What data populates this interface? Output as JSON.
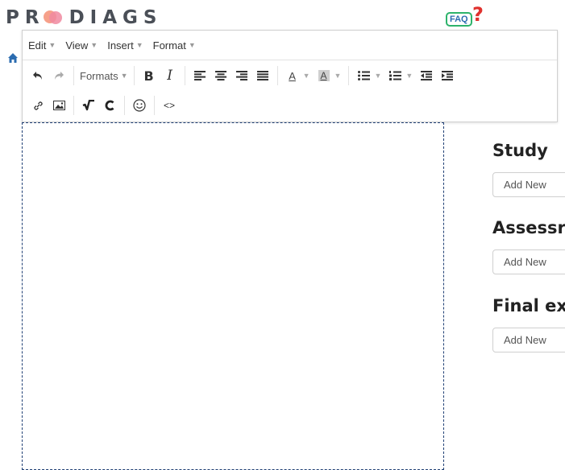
{
  "header": {
    "logo_left": "PR",
    "logo_right": "DIAGS",
    "faq_label": "FAQ",
    "faq_mark": "?"
  },
  "editor": {
    "menu": [
      {
        "label": "Edit"
      },
      {
        "label": "View"
      },
      {
        "label": "Insert"
      },
      {
        "label": "Format"
      }
    ],
    "formats_label": "Formats",
    "bold_label": "B",
    "italic_label": "I",
    "text_color_label": "A",
    "bg_color_label": "A",
    "code_label": "<>"
  },
  "sections": [
    {
      "title": "Study",
      "button": "Add New"
    },
    {
      "title": "Assessr",
      "button": "Add New"
    },
    {
      "title": "Final ex",
      "button": "Add New"
    }
  ],
  "colors": {
    "accent_blue": "#2b6cb0",
    "faq_green": "#2db36b",
    "faq_red": "#e0312d",
    "editor_border": "#1f3f74"
  }
}
